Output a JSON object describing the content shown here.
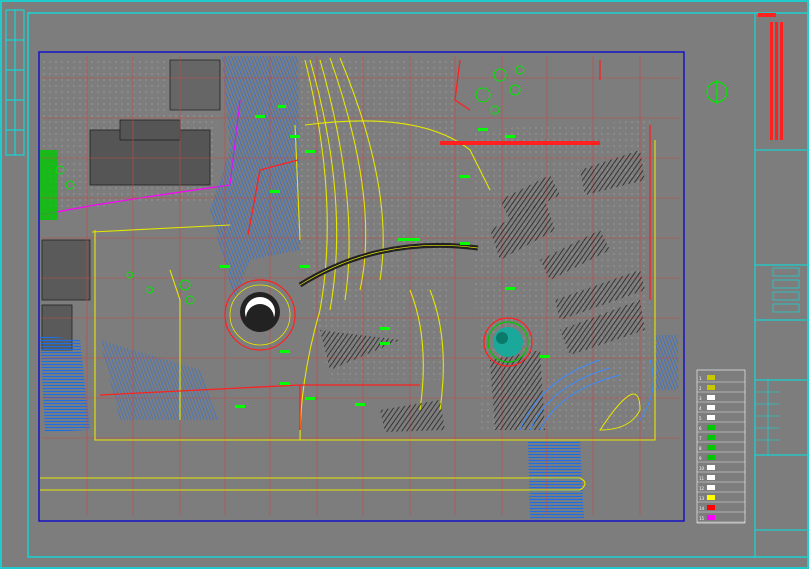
{
  "drawing": {
    "background_color": "#7d7d7d",
    "frame_color": "#00e5e5",
    "viewport_color": "#1414c8",
    "grid_color": "#c84646"
  },
  "plan_labels": {
    "center_top": "",
    "path_tags": [],
    "north_arrow_text": ""
  },
  "legend": {
    "title": "",
    "rows": [
      {
        "num": "1",
        "swatch": "#c8c800",
        "text": ""
      },
      {
        "num": "2",
        "swatch": "#c8c800",
        "text": ""
      },
      {
        "num": "3",
        "swatch": "#ffffff",
        "text": ""
      },
      {
        "num": "4",
        "swatch": "#ffffff",
        "text": ""
      },
      {
        "num": "5",
        "swatch": "#ffffff",
        "text": ""
      },
      {
        "num": "6",
        "swatch": "#00c800",
        "text": ""
      },
      {
        "num": "7",
        "swatch": "#00c800",
        "text": ""
      },
      {
        "num": "8",
        "swatch": "#00c800",
        "text": ""
      },
      {
        "num": "9",
        "swatch": "#00c800",
        "text": ""
      },
      {
        "num": "10",
        "swatch": "#ffffff",
        "text": ""
      },
      {
        "num": "11",
        "swatch": "#ffffff",
        "text": ""
      },
      {
        "num": "12",
        "swatch": "#ffffff",
        "text": ""
      },
      {
        "num": "13",
        "swatch": "#ffff00",
        "text": ""
      },
      {
        "num": "14",
        "swatch": "#ff0000",
        "text": ""
      },
      {
        "num": "15",
        "swatch": "#ff00ff",
        "text": ""
      }
    ]
  },
  "title_block": {
    "accent": "#ff2020",
    "fields": [
      "",
      "",
      "",
      ""
    ],
    "sheet_rows": [
      "",
      "",
      "",
      "",
      ""
    ]
  }
}
